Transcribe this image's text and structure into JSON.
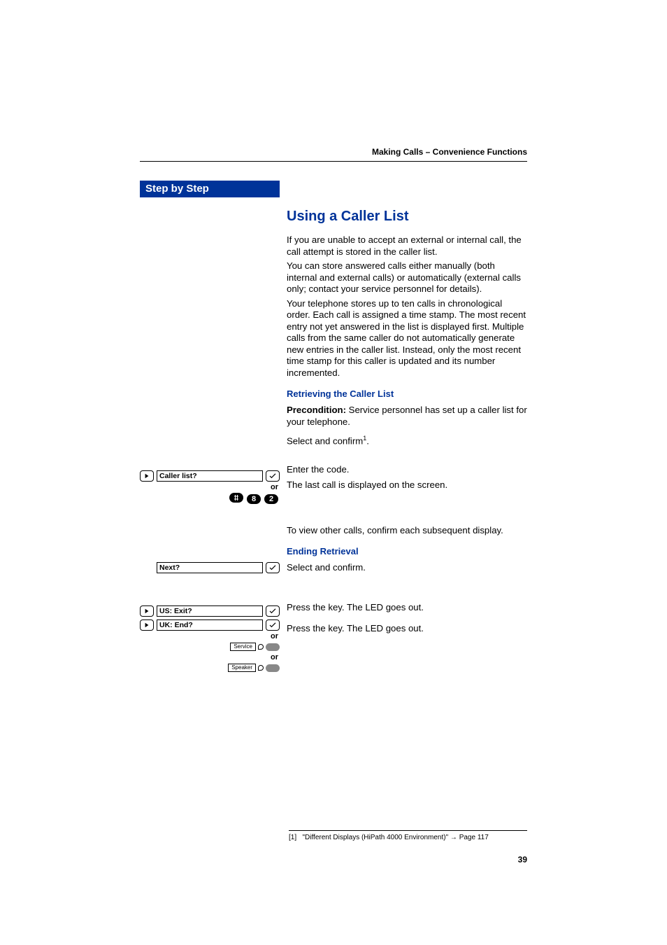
{
  "header": {
    "breadcrumb": "Making Calls – Convenience Functions"
  },
  "sidebar": {
    "title": "Step by Step",
    "prompts": {
      "caller_list": "Caller list?",
      "next": "Next?",
      "exit_us": "US: Exit?",
      "exit_uk": "UK: End?"
    },
    "or_label": "or",
    "code_keys": [
      "#",
      "8",
      "2"
    ],
    "hw_keys": {
      "service": "Service",
      "speaker": "Speaker"
    }
  },
  "main": {
    "title": "Using a Caller List",
    "intro_p1": "If you are unable to accept an external or internal call, the call attempt is stored in the caller list.",
    "intro_p2": "You can store answered calls either manually (both internal and external calls) or automatically (external calls only; contact your service personnel for details).",
    "intro_p3": "Your telephone stores up to ten calls in chronological order. Each call is assigned a time stamp. The most recent entry not yet answered in the list is displayed first. Multiple calls from the same caller do not automatically generate new entries in the caller list. Instead, only the most recent time stamp for this caller is updated and its number incremented.",
    "retrieving_h": "Retrieving the Caller List",
    "precond_label": "Precondition:",
    "precond_text": " Service personnel has set up a caller list for your telephone.",
    "select_confirm": "Select and confirm",
    "fn_mark": "1",
    "enter_code": "Enter the code.",
    "last_call": "The last call is displayed on the screen.",
    "view_other": "To view other calls, confirm each subsequent display.",
    "ending_h": "Ending Retrieval",
    "select_confirm2": "Select and confirm.",
    "press_key1": "Press the key. The LED goes out.",
    "press_key2": "Press the key. The LED goes out."
  },
  "footnote": {
    "num": "[1]",
    "text": "\"Different Displays (HiPath 4000 Environment)\" ",
    "arrow": "→",
    "page_ref": " Page 117"
  },
  "page_number": "39"
}
